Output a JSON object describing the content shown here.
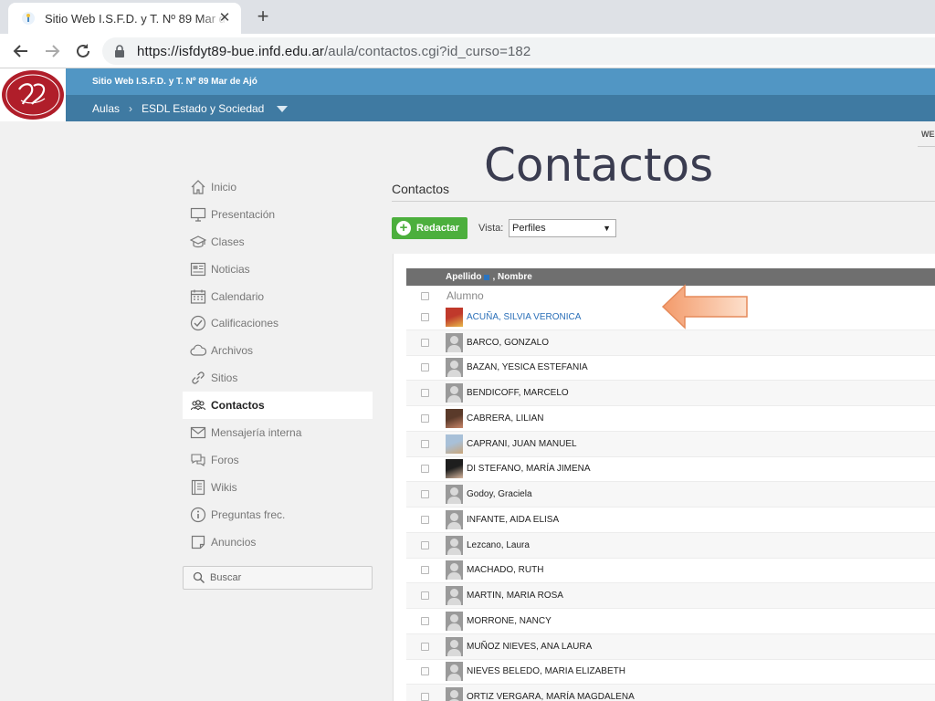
{
  "browser": {
    "tab_title": "Sitio Web I.S.F.D. y T. Nº 89 Mar de Ajó",
    "url_host": "https://isfdyt89-bue.infd.edu.ar",
    "url_path": "/aula/contactos.cgi?id_curso=182"
  },
  "header": {
    "site_name": "Sitio Web I.S.F.D. y T. Nº 89 Mar de Ajó",
    "crumb_1": "Aulas",
    "crumb_2": "ESDL Estado y Sociedad",
    "corner": "WE"
  },
  "sidebar": {
    "items": [
      {
        "label": "Inicio",
        "icon": "home-icon"
      },
      {
        "label": "Presentación",
        "icon": "monitor-icon"
      },
      {
        "label": "Clases",
        "icon": "graduation-cap-icon"
      },
      {
        "label": "Noticias",
        "icon": "newspaper-icon"
      },
      {
        "label": "Calendario",
        "icon": "calendar-icon"
      },
      {
        "label": "Calificaciones",
        "icon": "check-circle-icon"
      },
      {
        "label": "Archivos",
        "icon": "cloud-icon"
      },
      {
        "label": "Sitios",
        "icon": "link-icon"
      },
      {
        "label": "Contactos",
        "icon": "people-icon"
      },
      {
        "label": "Mensajería interna",
        "icon": "envelope-icon"
      },
      {
        "label": "Foros",
        "icon": "chat-icon"
      },
      {
        "label": "Wikis",
        "icon": "book-icon"
      },
      {
        "label": "Preguntas frec.",
        "icon": "info-icon"
      },
      {
        "label": "Anuncios",
        "icon": "note-icon"
      }
    ],
    "search_placeholder": "Buscar"
  },
  "main": {
    "big_title": "Contactos",
    "page_title": "Contactos",
    "compose_label": "Redactar",
    "vista_label": "Vista:",
    "vista_value": "Perfiles",
    "col_surname": "Apellido",
    "col_name": ", Nombre",
    "group_label": "Alumno",
    "contacts": [
      {
        "name": "ACUÑA, SILVIA VERONICA",
        "photo": true,
        "colors": [
          "#c0392b",
          "#e8b84a"
        ]
      },
      {
        "name": "BARCO, GONZALO",
        "photo": false
      },
      {
        "name": "BAZAN, YESICA ESTEFANIA",
        "photo": false
      },
      {
        "name": "BENDICOFF, MARCELO",
        "photo": false
      },
      {
        "name": "CABRERA, LILIAN",
        "photo": true,
        "colors": [
          "#5a3a2a",
          "#c9876a"
        ]
      },
      {
        "name": "CAPRANI, JUAN MANUEL",
        "photo": true,
        "colors": [
          "#a8c0d8",
          "#c9a57a"
        ]
      },
      {
        "name": "DI STEFANO, MARÍA JIMENA",
        "photo": true,
        "colors": [
          "#1e1e1e",
          "#d8b8a0"
        ]
      },
      {
        "name": "Godoy, Graciela",
        "photo": false
      },
      {
        "name": "INFANTE, AIDA ELISA",
        "photo": false
      },
      {
        "name": "Lezcano, Laura",
        "photo": false
      },
      {
        "name": "MACHADO, RUTH",
        "photo": false
      },
      {
        "name": "MARTIN, MARIA ROSA",
        "photo": false
      },
      {
        "name": "MORRONE, NANCY",
        "photo": false
      },
      {
        "name": "MUÑOZ NIEVES, ANA LAURA",
        "photo": false
      },
      {
        "name": "NIEVES BELEDO, MARIA ELIZABETH",
        "photo": false
      },
      {
        "name": "ORTIZ VERGARA, MARÍA MAGDALENA",
        "photo": false
      }
    ]
  },
  "colors": {
    "header_top": "#5196c4",
    "header_bottom": "#3f7aa2",
    "compose_green": "#4caf3d",
    "link_blue": "#2a6fb8",
    "annotation_orange": "#f4a87a"
  }
}
